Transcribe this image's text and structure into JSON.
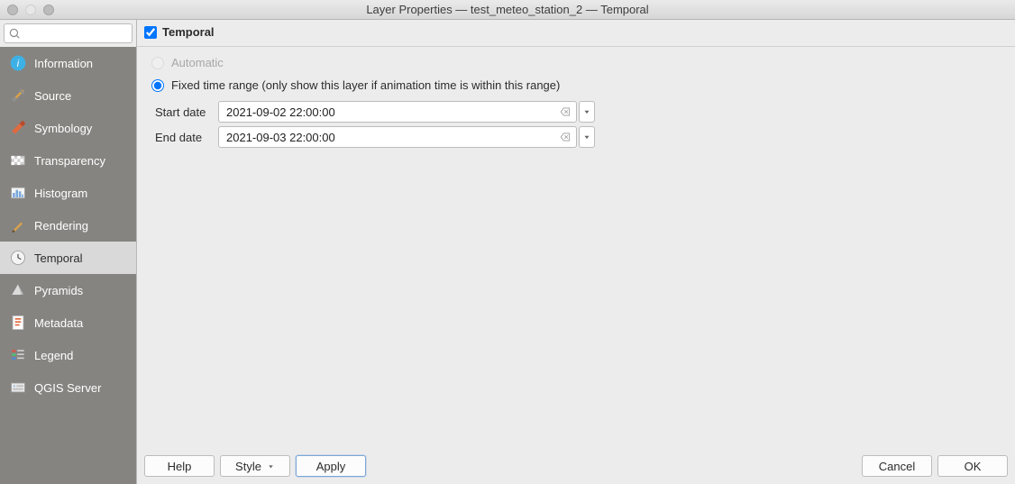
{
  "window": {
    "title": "Layer Properties — test_meteo_station_2 — Temporal"
  },
  "search": {
    "placeholder": ""
  },
  "sidebar": {
    "items": [
      {
        "id": "information",
        "label": "Information"
      },
      {
        "id": "source",
        "label": "Source"
      },
      {
        "id": "symbology",
        "label": "Symbology"
      },
      {
        "id": "transparency",
        "label": "Transparency"
      },
      {
        "id": "histogram",
        "label": "Histogram"
      },
      {
        "id": "rendering",
        "label": "Rendering"
      },
      {
        "id": "temporal",
        "label": "Temporal"
      },
      {
        "id": "pyramids",
        "label": "Pyramids"
      },
      {
        "id": "metadata",
        "label": "Metadata"
      },
      {
        "id": "legend",
        "label": "Legend"
      },
      {
        "id": "qgisserver",
        "label": "QGIS Server"
      }
    ],
    "active": "temporal"
  },
  "panel": {
    "title": "Temporal",
    "enabled": true,
    "options": {
      "automatic": "Automatic",
      "fixed": "Fixed time range (only show this layer if animation time is within this range)"
    },
    "selected": "fixed",
    "start": {
      "label": "Start date",
      "value": "2021-09-02 22:00:00"
    },
    "end": {
      "label": "End date",
      "value": "2021-09-03 22:00:00"
    }
  },
  "buttons": {
    "help": "Help",
    "style": "Style",
    "apply": "Apply",
    "cancel": "Cancel",
    "ok": "OK"
  }
}
